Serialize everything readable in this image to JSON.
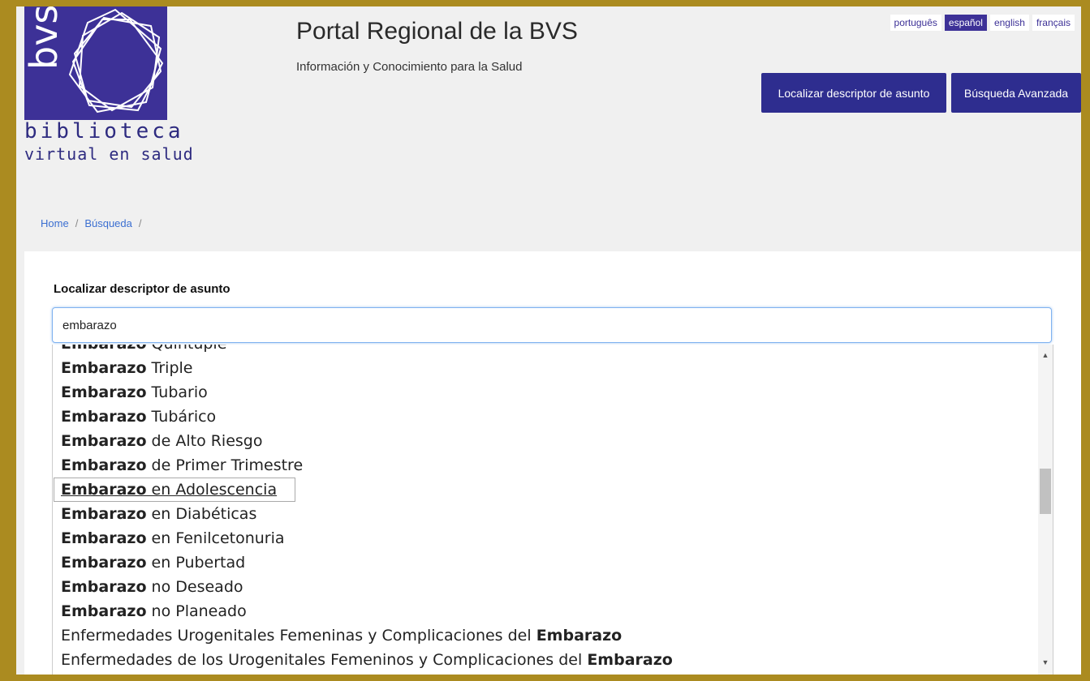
{
  "brand": {
    "logo_text": "bvs",
    "caption_line1": "biblioteca",
    "caption_line2": "virtual en salud",
    "accent": "#3d3197"
  },
  "header": {
    "title": "Portal Regional de la BVS",
    "subtitle": "Información y Conocimiento para la Salud",
    "languages": [
      "português",
      "español",
      "english",
      "français"
    ],
    "active_language": "español",
    "descriptor_button": "Localizar descriptor de asunto",
    "advanced_button": "Búsqueda Avanzada"
  },
  "breadcrumb": {
    "home": "Home",
    "search": "Búsqueda",
    "separator": "/"
  },
  "search": {
    "label": "Localizar descriptor de asunto",
    "value": "embarazo"
  },
  "suggestions": [
    {
      "bold": "Embarazo",
      "rest": " Quintuple",
      "prefix": ""
    },
    {
      "bold": "Embarazo",
      "rest": " Triple",
      "prefix": ""
    },
    {
      "bold": "Embarazo",
      "rest": " Tubario",
      "prefix": ""
    },
    {
      "bold": "Embarazo",
      "rest": " Tubárico",
      "prefix": ""
    },
    {
      "bold": "Embarazo",
      "rest": " de Alto Riesgo",
      "prefix": ""
    },
    {
      "bold": "Embarazo",
      "rest": " de Primer Trimestre",
      "prefix": ""
    },
    {
      "bold": "Embarazo",
      "rest": " en Adolescencia",
      "prefix": "",
      "selected": true
    },
    {
      "bold": "Embarazo",
      "rest": " en Diabéticas",
      "prefix": ""
    },
    {
      "bold": "Embarazo",
      "rest": " en Fenilcetonuria",
      "prefix": ""
    },
    {
      "bold": "Embarazo",
      "rest": " en Pubertad",
      "prefix": ""
    },
    {
      "bold": "Embarazo",
      "rest": " no Deseado",
      "prefix": ""
    },
    {
      "bold": "Embarazo",
      "rest": " no Planeado",
      "prefix": ""
    },
    {
      "bold": "Embarazo",
      "rest": "",
      "prefix": "Enfermedades Urogenitales Femeninas y Complicaciones del "
    },
    {
      "bold": "Embarazo",
      "rest": "",
      "prefix": "Enfermedades de los Urogenitales Femeninos y Complicaciones del "
    }
  ]
}
